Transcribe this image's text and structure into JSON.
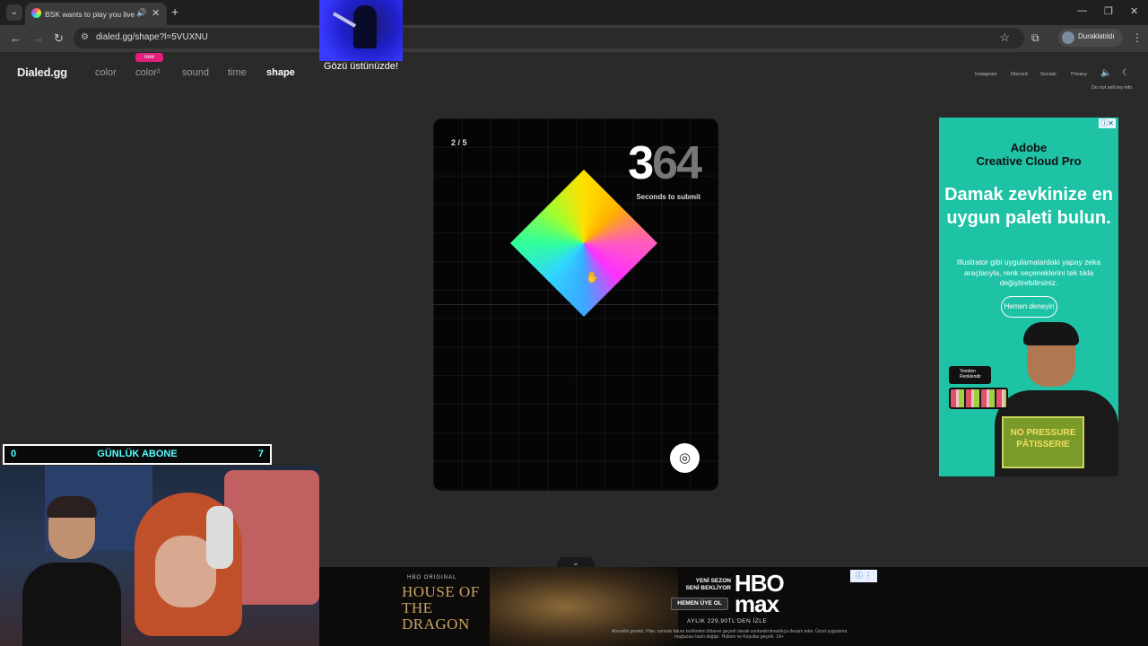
{
  "browser": {
    "tab_title": "BSK wants to play you live",
    "url": "dialed.gg/shape?l=5VUXNU",
    "profile_name": "Duraklatıldı"
  },
  "site": {
    "logo": "Dialed.gg",
    "nav": [
      "color",
      "color²",
      "sound",
      "time",
      "shape"
    ],
    "active_nav": "shape",
    "new_badge": "new",
    "right_links": [
      "Instagram",
      "Discord",
      "Socials",
      "Privacy"
    ],
    "do_not_sell": "Do not sell my info"
  },
  "overlay": {
    "caption": "Gözü üstünüzde!"
  },
  "game": {
    "round": "2 / 5",
    "timer_lead": "3",
    "timer_rest": "64",
    "timer_label": "Seconds to submit"
  },
  "right_ad": {
    "brand": "Adobe\nCreative Cloud Pro",
    "headline": "Damak zevkinize en uygun paleti bulun.",
    "body": "Illustrator gibi uygulamalardaki yapay zeka araçlarıyla, renk seçeneklerini tek tıkla değiştirebilirsiniz.",
    "cta": "Hemen deneyin",
    "sticker": "Yeniden Renklendir",
    "box_text": "NO PRESSURE PÂTISSERIE"
  },
  "stream": {
    "sub_left": "0",
    "sub_title": "GÜNLÜK ABONE",
    "sub_right": "7"
  },
  "bottom_ad": {
    "hbo_original": "HBO ORIGINAL",
    "title": "HOUSE OF THE DRAGON",
    "tagline": "YENİ SEZON SENİ BEKLİYOR",
    "cta": "HEMEN ÜYE OL",
    "logo": "HBO max",
    "price": "AYLIK 229,90TL'DEN İZLE",
    "fine_print": "Abonelik gerekir. Plan, sonraki fatura tarihinden itibaren geçerli olarak sonlandırılmadıkça devam eder. Ücret uygulama mağazası bazlı değişir. Hüküm ve Koşullar geçerli. 18+"
  }
}
